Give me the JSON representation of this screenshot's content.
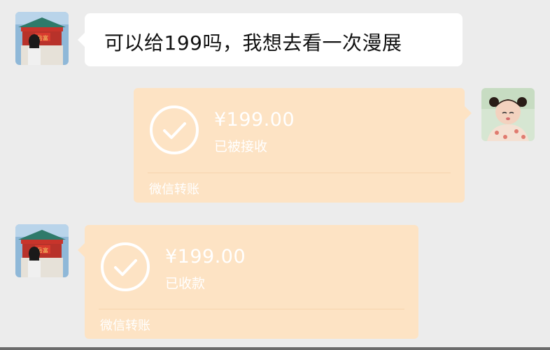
{
  "messages": {
    "incoming_text": "可以给199吗，我想去看一次漫展",
    "outgoing_transfer": {
      "amount": "¥199.00",
      "status": "已被接收",
      "footer": "微信转账"
    },
    "incoming_transfer": {
      "amount": "¥199.00",
      "status": "已收款",
      "footer": "微信转账"
    }
  },
  "colors": {
    "background": "#ececec",
    "bubble_white": "#ffffff",
    "transfer_received": "#fde3c4"
  },
  "icons": [
    "avatar-gate-girl",
    "avatar-child",
    "check-circle-icon"
  ],
  "avatar_sign_text": "岳富"
}
